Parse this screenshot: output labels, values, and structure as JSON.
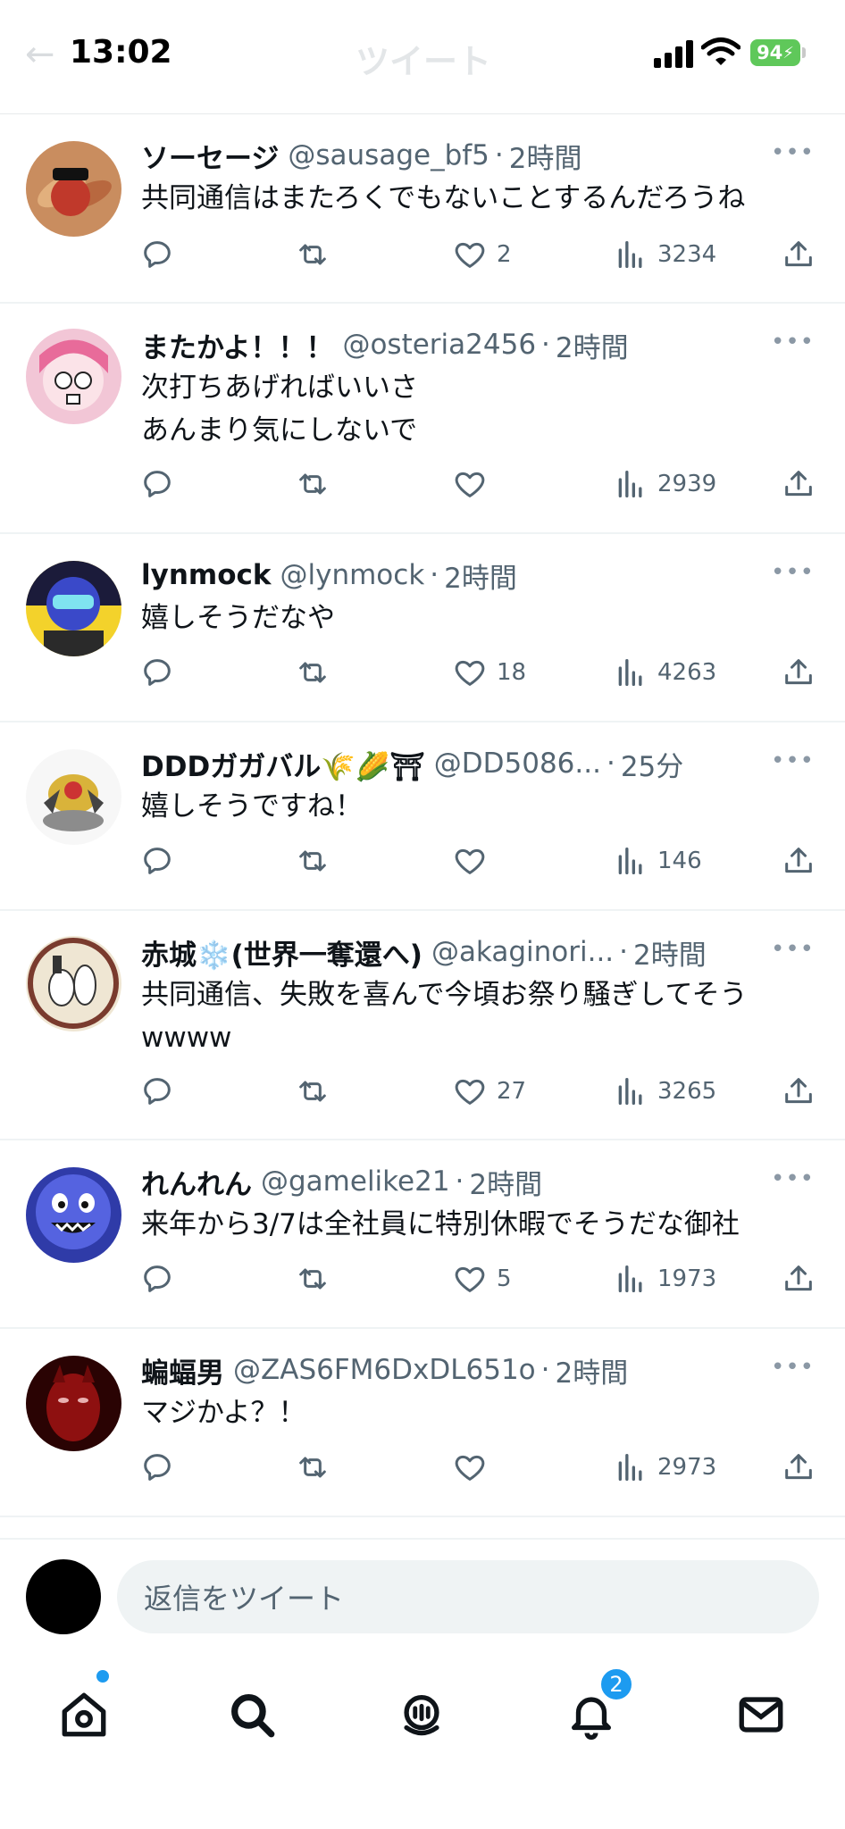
{
  "status_bar": {
    "time": "13:02",
    "battery": "94",
    "faded_title": "ツイート"
  },
  "tweets": [
    {
      "name": "ソーセージ",
      "handle": "@sausage_bf5",
      "time": "2時間",
      "text": "共同通信はまたろくでもないことするんだろうね",
      "likes": "2",
      "views": "3234"
    },
    {
      "name": "またかよ！！！",
      "handle": "@osteria2456",
      "time": "2時間",
      "text": "次打ちあげればいいさ\nあんまり気にしないで",
      "likes": "",
      "views": "2939"
    },
    {
      "name": "lynmock",
      "handle": "@lynmock",
      "time": "2時間",
      "text": "嬉しそうだなや",
      "likes": "18",
      "views": "4263"
    },
    {
      "name": "DDDガガバル🌾🌽⛩",
      "handle": "@DD5086...",
      "time": "25分",
      "text": "嬉しそうですね！",
      "likes": "",
      "views": "146"
    },
    {
      "name": "赤城❄️(世界一奪還へ)",
      "handle": "@akaginori...",
      "time": "2時間",
      "text": "共同通信、失敗を喜んで今頃お祭り騒ぎしてそう\nwwww",
      "likes": "27",
      "views": "3265"
    },
    {
      "name": "れんれん",
      "handle": "@gamelike21",
      "time": "2時間",
      "text": "来年から3/7は全社員に特別休暇でそうだな御社",
      "likes": "5",
      "views": "1973"
    },
    {
      "name": "蝙蝠男",
      "handle": "@ZAS6FM6DxDL651o",
      "time": "2時間",
      "text": "マジかよ？！",
      "likes": "",
      "views": "2973"
    }
  ],
  "reply": {
    "placeholder": "返信をツイート"
  },
  "tabbar": {
    "notifications_badge": "2"
  },
  "icons": {
    "reply": "reply-icon",
    "retweet": "retweet-icon",
    "like": "heart-icon",
    "views": "views-icon",
    "share": "share-icon",
    "more": "more-icon",
    "home": "home-icon",
    "search": "search-icon",
    "spaces": "spaces-icon",
    "notifications": "bell-icon",
    "messages": "mail-icon"
  },
  "colors": {
    "accent": "#1d9bf0",
    "secondary_text": "#536471",
    "battery": "#5fc85a"
  }
}
